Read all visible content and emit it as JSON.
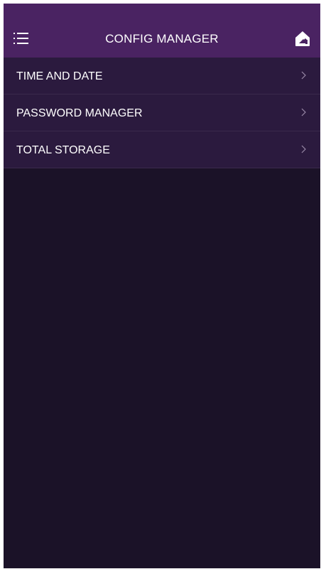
{
  "header": {
    "title": "CONFIG MANAGER",
    "menu_icon": "hamburger-menu-icon",
    "home_icon": "home-icon"
  },
  "items": [
    {
      "label": "TIME AND DATE",
      "icon": "chevron-right-icon"
    },
    {
      "label": "PASSWORD MANAGER",
      "icon": "chevron-right-icon"
    },
    {
      "label": "TOTAL STORAGE",
      "icon": "chevron-right-icon"
    }
  ],
  "colors": {
    "header_bg": "#4a2362",
    "list_bg": "#2b1a3e",
    "screen_bg": "#1b1228",
    "text": "#ffffff"
  }
}
